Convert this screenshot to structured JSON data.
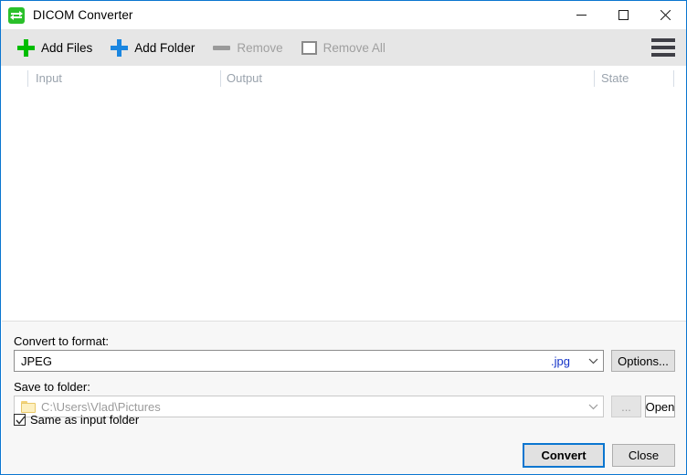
{
  "window": {
    "title": "DICOM Converter",
    "app_icon": "convert-swap-icon",
    "accent_color": "#0b76d0",
    "controls": {
      "minimize": "minimize-icon",
      "maximize": "maximize-icon",
      "close": "close-icon"
    }
  },
  "toolbar": {
    "add_files_label": "Add Files",
    "add_folder_label": "Add Folder",
    "remove_label": "Remove",
    "remove_all_label": "Remove All",
    "menu_icon": "hamburger-menu-icon",
    "add_files_icon_color": "#00bd00",
    "add_folder_icon_color": "#1a86e0"
  },
  "file_list": {
    "columns": [
      {
        "label": "Input"
      },
      {
        "label": "Output"
      },
      {
        "label": "State"
      }
    ],
    "rows": []
  },
  "format_section": {
    "label": "Convert to format:",
    "value": "JPEG",
    "extension": ".jpg",
    "options_button": "Options...",
    "extension_color": "#1433c8"
  },
  "folder_section": {
    "label": "Save to folder:",
    "path": "C:\\Users\\Vlad\\Pictures",
    "folder_icon": "folder-icon",
    "browse_button": "...",
    "open_button": "Open",
    "checkbox_label": "Same as input folder",
    "checkbox_checked": true
  },
  "actions": {
    "convert_label": "Convert",
    "close_label": "Close"
  }
}
